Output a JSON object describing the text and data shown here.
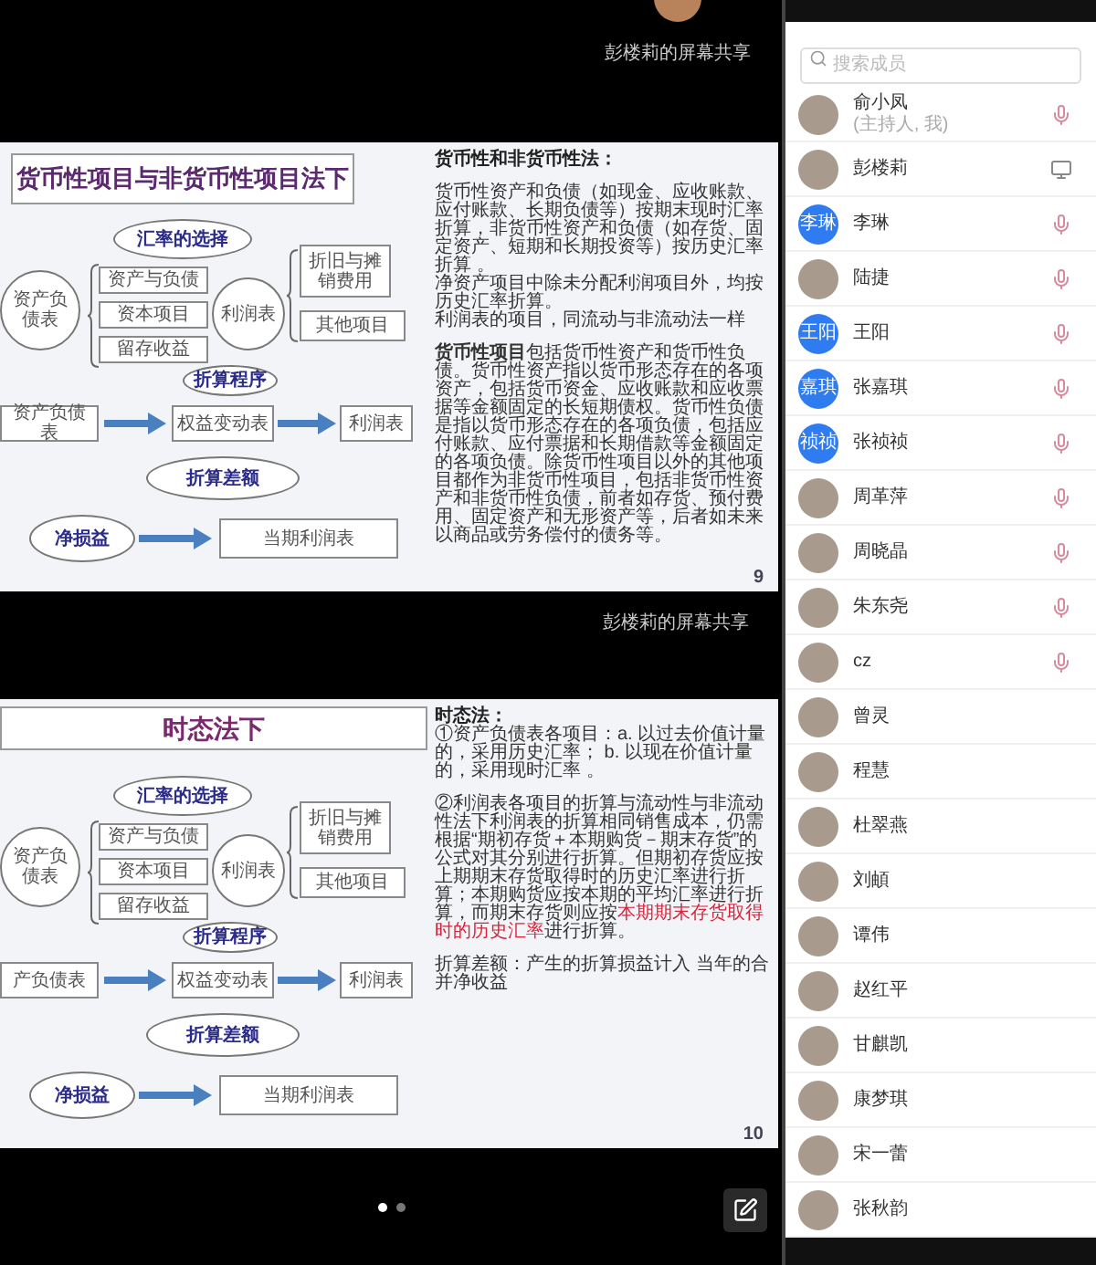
{
  "share_label_top": "彭楼莉的屏幕共享",
  "slides": [
    {
      "title": "货币性项目与非货币性项目法下",
      "page": "9",
      "diagram": [
        {
          "kind": "ellipse",
          "text": "汇率的选择"
        },
        {
          "kind": "circle",
          "text": "资产负债表"
        },
        {
          "kind": "box",
          "text": "资产与负债"
        },
        {
          "kind": "box",
          "text": "资本项目"
        },
        {
          "kind": "box",
          "text": "留存收益"
        },
        {
          "kind": "circle",
          "text": "利润表"
        },
        {
          "kind": "box",
          "text": "折旧与摊销费用"
        },
        {
          "kind": "box",
          "text": "其他项目"
        },
        {
          "kind": "ellipse",
          "text": "折算程序"
        },
        {
          "kind": "box",
          "text": "资产负债表"
        },
        {
          "kind": "box",
          "text": "权益变动表"
        },
        {
          "kind": "box",
          "text": "利润表"
        },
        {
          "kind": "ellipse",
          "text": "折算差额"
        },
        {
          "kind": "ellipse",
          "text": "净损益"
        },
        {
          "kind": "box",
          "text": "当期利润表"
        }
      ],
      "notes": [
        [
          {
            "kind": "heading",
            "text": "货币性和非货币性法："
          }
        ],
        [
          {
            "kind": "text",
            "text": "货币性资产和负债（如现金、应收账款、应付账款、长期负债等）按期末现时汇率折算，非货币性资产和负债（如存货、固定资产、短期和长期投资等）按历史汇率折算 。"
          },
          {
            "kind": "text",
            "text": "净资产项目中除未分配利润项目外，均按历史汇率折算。"
          },
          {
            "kind": "text",
            "text": "利润表的项目，同流动与非流动法一样"
          }
        ],
        [
          {
            "kind": "text",
            "text": "**货币性项目**包括货币性资产和货币性负债。货币性资产指以货币形态存在的各项资产，包括货币资金、应收账款和应收票据等金额固定的长短期债权。货币性负债是指以货币形态存在的各项负债，包括应付账款、应付票据和长期借款等金额固定的各项负债。除货币性项目以外的其他项目都作为非货币性项目，包括非货币性资产和非货币性负债，前者如存货、预付费用、固定资产和无形资产等，后者如未来以商品或劳务偿付的债务等。"
          }
        ]
      ]
    },
    {
      "title": "时态法下",
      "page": "10",
      "diagram": [
        {
          "kind": "ellipse",
          "text": "汇率的选择"
        },
        {
          "kind": "circle",
          "text": "资产负债表"
        },
        {
          "kind": "box",
          "text": "资产与负债"
        },
        {
          "kind": "box",
          "text": "资本项目"
        },
        {
          "kind": "box",
          "text": "留存收益"
        },
        {
          "kind": "circle",
          "text": "利润表"
        },
        {
          "kind": "box",
          "text": "折旧与摊销费用"
        },
        {
          "kind": "box",
          "text": "其他项目"
        },
        {
          "kind": "ellipse",
          "text": "折算程序"
        },
        {
          "kind": "box",
          "text": "产负债表"
        },
        {
          "kind": "box",
          "text": "权益变动表"
        },
        {
          "kind": "box",
          "text": "利润表"
        },
        {
          "kind": "ellipse",
          "text": "折算差额"
        },
        {
          "kind": "ellipse",
          "text": "净损益"
        },
        {
          "kind": "box",
          "text": "当期利润表"
        }
      ],
      "notes": [
        [
          {
            "kind": "heading",
            "text": "时态法："
          },
          {
            "kind": "text",
            "text": "①资产负债表各项目：a. 以过去价值计量的，采用历史汇率； b. 以现在价值计量的，采用现时汇率 。"
          }
        ],
        [
          {
            "kind": "mixed",
            "segments": [
              {
                "text": "②利润表各项目的折算与流动性与非流动性法下利润表的折算相同销售成本，仍需根据“期初存货＋本期购货－期末存货”的公式对其分别进行折算。但期初存货应按上期期末存货取得时的历史汇率进行折算；本期购货应按本期的平均汇率进行折算，而期末存货则应按",
                "highlighted": false
              },
              {
                "text": "本期期末存货取得时的历史汇率",
                "highlighted": true
              },
              {
                "text": "进行折算。",
                "highlighted": false
              }
            ]
          }
        ],
        [
          {
            "kind": "text",
            "text": "折算差额：产生的折算损益计入 当年的合并净收益"
          }
        ]
      ]
    }
  ],
  "share_label_middle": "彭楼莉的屏幕共享",
  "pages": [
    {
      "selected": true
    },
    {
      "selected": false
    }
  ],
  "members_panel": {
    "search": {
      "placeholder": "搜索成员"
    },
    "members": [
      {
        "name": "俞小凤",
        "subtitle": "(主持人, 我)",
        "kind": "mic"
      },
      {
        "name": "彭楼莉",
        "kind": "screen"
      },
      {
        "name": "李琳",
        "avatar_text": "李琳",
        "kind": "mic"
      },
      {
        "name": "陆捷",
        "kind": "mic"
      },
      {
        "name": "王阳",
        "avatar_text": "王阳",
        "kind": "mic"
      },
      {
        "name": "张嘉琪",
        "avatar_text": "嘉琪",
        "kind": "mic"
      },
      {
        "name": "张祯祯",
        "avatar_text": "祯祯",
        "kind": "mic"
      },
      {
        "name": "周革萍",
        "kind": "mic"
      },
      {
        "name": "周晓晶",
        "kind": "mic"
      },
      {
        "name": "朱东尧",
        "kind": "mic"
      },
      {
        "name": "cz",
        "kind": "mic"
      },
      {
        "name": "曾灵"
      },
      {
        "name": "程慧"
      },
      {
        "name": "杜翠燕"
      },
      {
        "name": "刘頔"
      },
      {
        "name": "谭伟"
      },
      {
        "name": "赵红平"
      },
      {
        "name": "甘麒凯"
      },
      {
        "name": "康梦琪"
      },
      {
        "name": "宋一蕾"
      },
      {
        "name": "张秋韵"
      }
    ]
  }
}
